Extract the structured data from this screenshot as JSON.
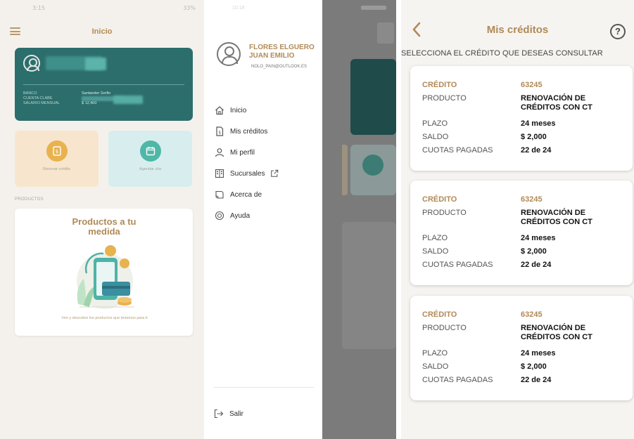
{
  "home": {
    "status_time": "3:15",
    "status_right": "33%",
    "title": "Inicio",
    "account": {
      "rows": [
        "BANCO",
        "CUENTA CLABE",
        "SALARIO MENSUAL"
      ],
      "bank": "Santander Serfin",
      "salary": "$ 12,400"
    },
    "quick": [
      {
        "label": "Renovar crédito"
      },
      {
        "label": "Agendar cita"
      }
    ],
    "section_label": "PRODUCTOS",
    "products": {
      "title": "Productos a tu medida",
      "caption": "Ven y descubre los productos que tenemos para ti"
    }
  },
  "drawer": {
    "status_time": "10:18",
    "user_name_line1": "FLORES ELGUERO",
    "user_name_line2": "JUAN EMILIO",
    "email": "NOLO_PAIN@OUTLOOK.ES",
    "items": [
      {
        "label": "Inicio",
        "icon": "home-icon"
      },
      {
        "label": "Mis créditos",
        "icon": "document-icon"
      },
      {
        "label": "Mi perfil",
        "icon": "user-icon"
      },
      {
        "label": "Sucursales",
        "icon": "building-icon"
      },
      {
        "label": "Acerca de",
        "icon": "info-icon"
      },
      {
        "label": "Ayuda",
        "icon": "help-chat-icon"
      }
    ],
    "logout_label": "Salir"
  },
  "credits": {
    "title": "Mis créditos",
    "help_symbol": "?",
    "instruction": "SELECCIONA EL CRÉDITO QUE DESEAS CONSULTAR",
    "labels": {
      "credit": "CRÉDITO",
      "product": "PRODUCTO",
      "term": "PLAZO",
      "balance": "SALDO",
      "paid": "CUOTAS PAGADAS"
    },
    "items": [
      {
        "credit": "63245",
        "product_line1": "RENOVACIÓN DE",
        "product_line2": "CRÉDITOS CON CT",
        "term": "24 meses",
        "balance": "$ 2,000",
        "paid": "22 de 24"
      },
      {
        "credit": "63245",
        "product_line1": "RENOVACIÓN DE",
        "product_line2": "CRÉDITOS CON CT",
        "term": "24 meses",
        "balance": "$ 2,000",
        "paid": "22 de 24"
      },
      {
        "credit": "63245",
        "product_line1": "RENOVACIÓN DE",
        "product_line2": "CRÉDITOS CON CT",
        "term": "24 meses",
        "balance": "$ 2,000",
        "paid": "22 de 24"
      }
    ]
  },
  "colors": {
    "accent_gold": "#b08a57",
    "teal_card": "#2c6e6c",
    "orange_icon": "#e8b24e",
    "teal_icon": "#4fb7a8"
  }
}
